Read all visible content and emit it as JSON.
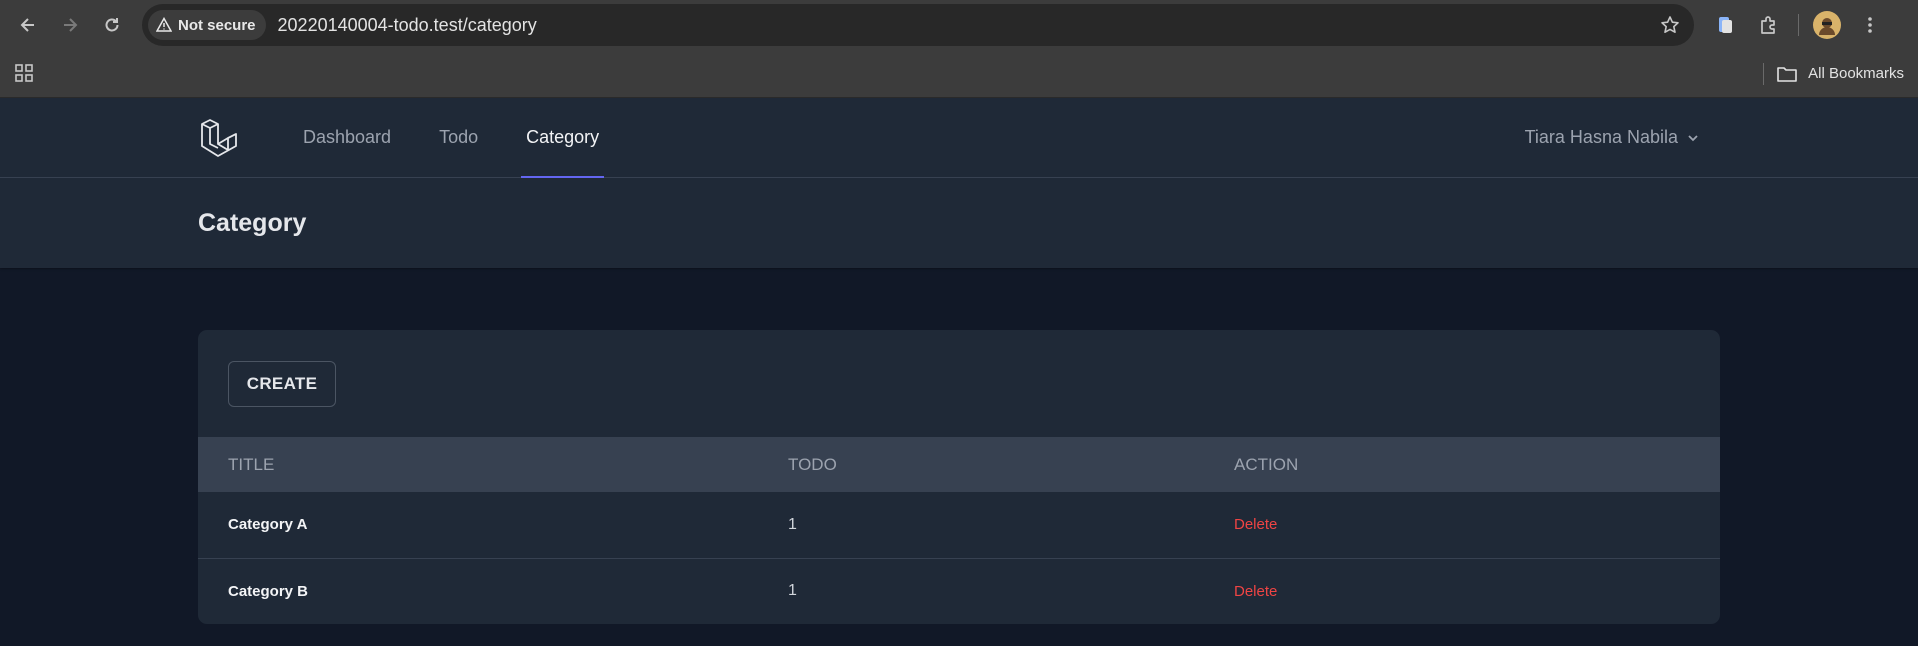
{
  "browser": {
    "security_label": "Not secure",
    "url": "20220140004-todo.test/category",
    "bookmarks_label": "All Bookmarks"
  },
  "nav": {
    "links": [
      {
        "label": "Dashboard",
        "active": false
      },
      {
        "label": "Todo",
        "active": false
      },
      {
        "label": "Category",
        "active": true
      }
    ],
    "user_name": "Tiara Hasna Nabila",
    "accent_color": "#6366f1"
  },
  "header": {
    "title": "Category"
  },
  "main": {
    "create_label": "CREATE",
    "table": {
      "columns": [
        "TITLE",
        "TODO",
        "ACTION"
      ],
      "rows": [
        {
          "title": "Category A",
          "todo": "1",
          "action": "Delete"
        },
        {
          "title": "Category B",
          "todo": "1",
          "action": "Delete"
        }
      ],
      "action_color": "#ef4444"
    }
  }
}
